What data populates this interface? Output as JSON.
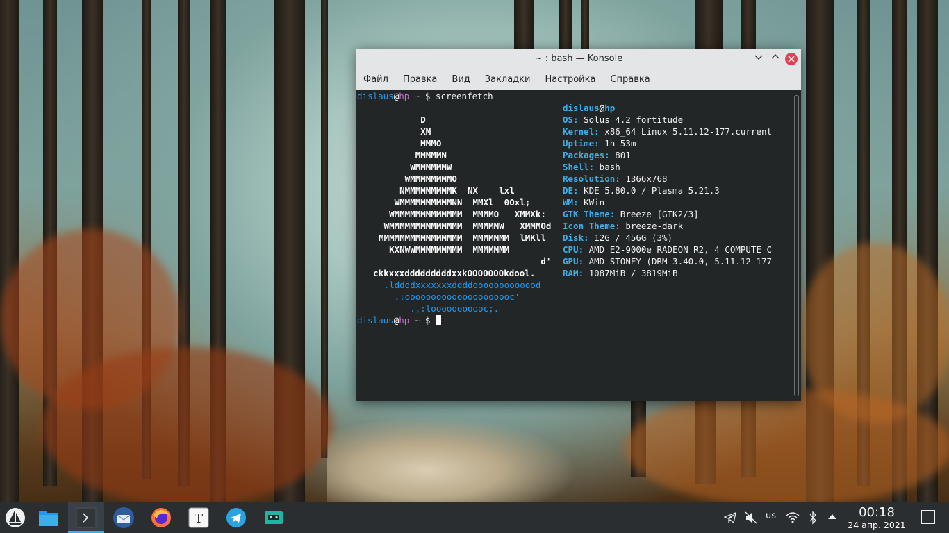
{
  "window": {
    "title": "~ : bash — Konsole",
    "menu": [
      "Файл",
      "Правка",
      "Вид",
      "Закладки",
      "Настройка",
      "Справка"
    ]
  },
  "terminal": {
    "prompt_user": "dislaus",
    "prompt_at": "@",
    "prompt_host": "hp",
    "prompt_path": " ~ ",
    "prompt_symbol": "$",
    "command": " screenfetch",
    "logo": [
      "          D",
      "          XM",
      "          MMMO",
      "         MMMMMN",
      "        WMMMMMMW",
      "       WMMMMMMMMO",
      "      NMMMMMMMMMK  NX    lxl",
      "     WMMMMMMMMMMNN  MMXl  0Oxl;",
      "    WMMMMMMMMMMMMM  MMMMO   XMMXk:",
      "   WMMMMMMMMMMMMMM  MMMMMW   XMMMOd",
      "  MMMMMMMMMMMMMMMM  MMMMMMM  lMKll",
      "    KXNWWMMMMMMMMM  MMMMMMM",
      "                                 d'",
      "  ckkxxxdddddddddxxkOOOOOOOkdool.",
      "   .lddddxxxxxxxddddooooooooooood",
      "     .:ooooooooooooooooooooc'",
      "        .,:looooooooooc;."
    ],
    "info_header_user": "dislaus",
    "info_header_at": "@",
    "info_header_host": "hp",
    "info": [
      {
        "key": "OS:",
        "value": " Solus 4.2 fortitude"
      },
      {
        "key": "Kernel:",
        "value": " x86_64 Linux 5.11.12-177.current"
      },
      {
        "key": "Uptime:",
        "value": " 1h 53m"
      },
      {
        "key": "Packages:",
        "value": " 801"
      },
      {
        "key": "Shell:",
        "value": " bash"
      },
      {
        "key": "Resolution:",
        "value": " 1366x768"
      },
      {
        "key": "DE:",
        "value": " KDE 5.80.0 / Plasma 5.21.3"
      },
      {
        "key": "WM:",
        "value": " KWin"
      },
      {
        "key": "GTK Theme:",
        "value": " Breeze [GTK2/3]"
      },
      {
        "key": "Icon Theme:",
        "value": " breeze-dark"
      },
      {
        "key": "Disk:",
        "value": " 12G / 456G (3%)"
      },
      {
        "key": "CPU:",
        "value": " AMD E2-9000e RADEON R2, 4 COMPUTE C"
      },
      {
        "key": "GPU:",
        "value": " AMD STONEY (DRM 3.40.0, 5.11.12-177"
      },
      {
        "key": "RAM:",
        "value": " 1087MiB / 3819MiB"
      }
    ]
  },
  "taskbar": {
    "apps": [
      "solus-menu-icon",
      "file-manager-icon",
      "konsole-icon",
      "thunderbird-icon",
      "firefox-icon",
      "typora-icon",
      "telegram-icon",
      "tape-app-icon"
    ],
    "keyboard_layout": "us",
    "time": "00:18",
    "date": "24 апр. 2021"
  },
  "colors": {
    "accent": "#3daee9",
    "prompt_user": "#1d99f3",
    "prompt_host": "#c86fd4",
    "close_button": "#da4453"
  }
}
